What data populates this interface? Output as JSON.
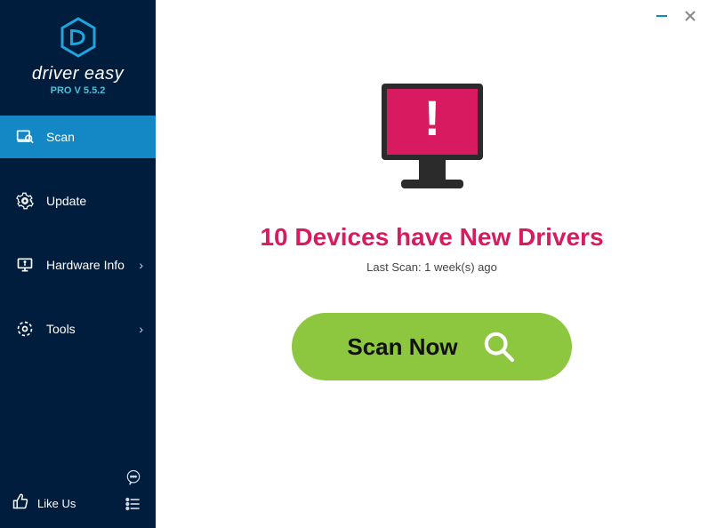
{
  "brand": {
    "name": "driver easy",
    "version": "PRO V 5.5.2"
  },
  "sidebar": {
    "items": [
      {
        "label": "Scan"
      },
      {
        "label": "Update"
      },
      {
        "label": "Hardware Info"
      },
      {
        "label": "Tools"
      }
    ],
    "like_label": "Like Us"
  },
  "main": {
    "headline": "10 Devices have New Drivers",
    "last_scan": "Last Scan: 1 week(s) ago",
    "scan_button": "Scan Now"
  },
  "colors": {
    "sidebar_bg": "#011d3d",
    "active_bg": "#1487c5",
    "accent_cyan": "#4dbfd8",
    "alert_pink": "#d81b60",
    "scan_green": "#8dc63f"
  }
}
